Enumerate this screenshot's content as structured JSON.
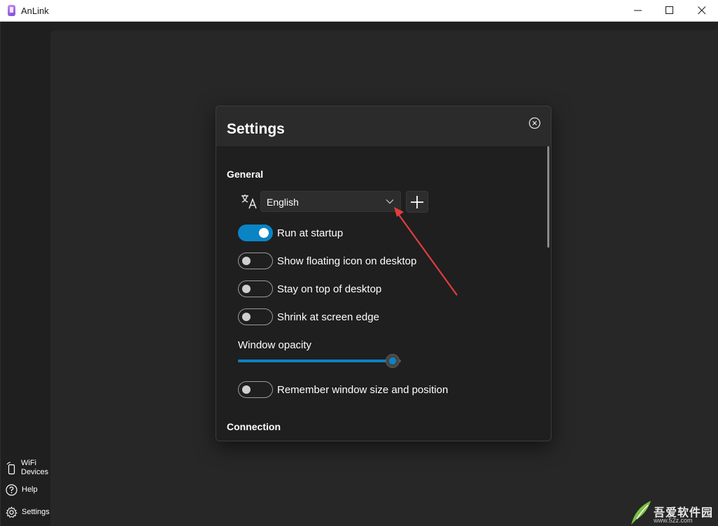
{
  "window": {
    "title": "AnLink"
  },
  "sidebar": {
    "items": [
      {
        "label": "WiFi Devices",
        "icon": "phone-wifi-icon"
      },
      {
        "label": "Help",
        "icon": "help-icon"
      },
      {
        "label": "Settings",
        "icon": "gear-icon"
      }
    ]
  },
  "dialog": {
    "title": "Settings",
    "general_title": "General",
    "language": {
      "value": "English",
      "icon": "translate-icon"
    },
    "toggles": [
      {
        "label": "Run at startup",
        "checked": true
      },
      {
        "label": "Show floating icon on desktop",
        "checked": false
      },
      {
        "label": "Stay on top of desktop",
        "checked": false
      },
      {
        "label": "Shrink at screen edge",
        "checked": false
      }
    ],
    "opacity": {
      "label": "Window opacity",
      "value": 0.95
    },
    "remember": {
      "label": "Remember window size and position",
      "checked": false
    },
    "connection_title": "Connection"
  },
  "annotation": {
    "color": "#e23d3d"
  },
  "watermark": {
    "text": "吾爱软件园",
    "url": "www.52z.com"
  },
  "colors": {
    "accent": "#0b84c4",
    "dialog_bg": "#1f1f1f",
    "app_bg": "#272727"
  }
}
